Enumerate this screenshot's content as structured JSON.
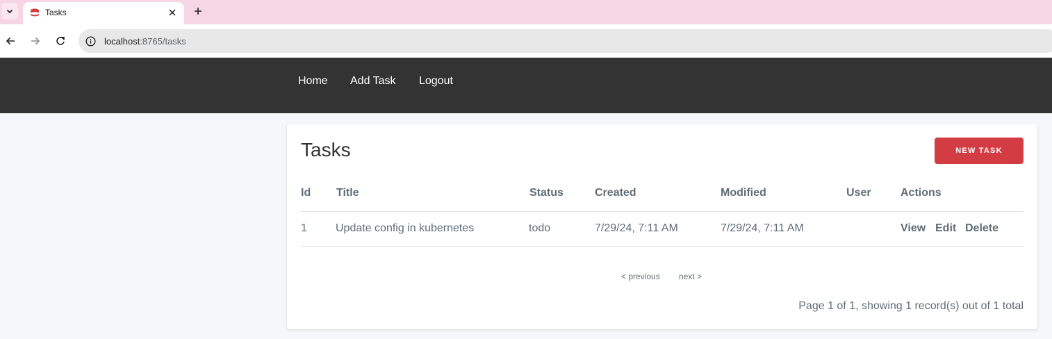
{
  "browser": {
    "tab_title": "Tasks",
    "url_host": "localhost",
    "url_rest": ":8765/tasks"
  },
  "nav": {
    "home": "Home",
    "add_task": "Add Task",
    "logout": "Logout"
  },
  "page": {
    "title": "Tasks",
    "new_task_label": "NEW TASK"
  },
  "table": {
    "headers": [
      "Id",
      "Title",
      "Status",
      "Created",
      "Modified",
      "User",
      "Actions"
    ],
    "rows": [
      {
        "id": "1",
        "title": "Update config in kubernetes",
        "status": "todo",
        "created": "7/29/24, 7:11 AM",
        "modified": "7/29/24, 7:11 AM",
        "user": "",
        "actions": [
          "View",
          "Edit",
          "Delete"
        ]
      }
    ]
  },
  "pagination": {
    "previous": "< previous",
    "next": "next >",
    "summary": "Page 1 of 1, showing 1 record(s) out of 1 total"
  },
  "colors": {
    "navbar": "#333333",
    "accent": "#d33c43",
    "tabstrip": "#f6d5e4"
  },
  "icons": {
    "tab_search": "chevron-down-icon",
    "favicon": "cakephp-icon",
    "close": "close-icon",
    "new_tab": "plus-icon",
    "back": "arrow-left-icon",
    "forward": "arrow-right-icon",
    "reload": "reload-icon",
    "info": "info-icon"
  }
}
